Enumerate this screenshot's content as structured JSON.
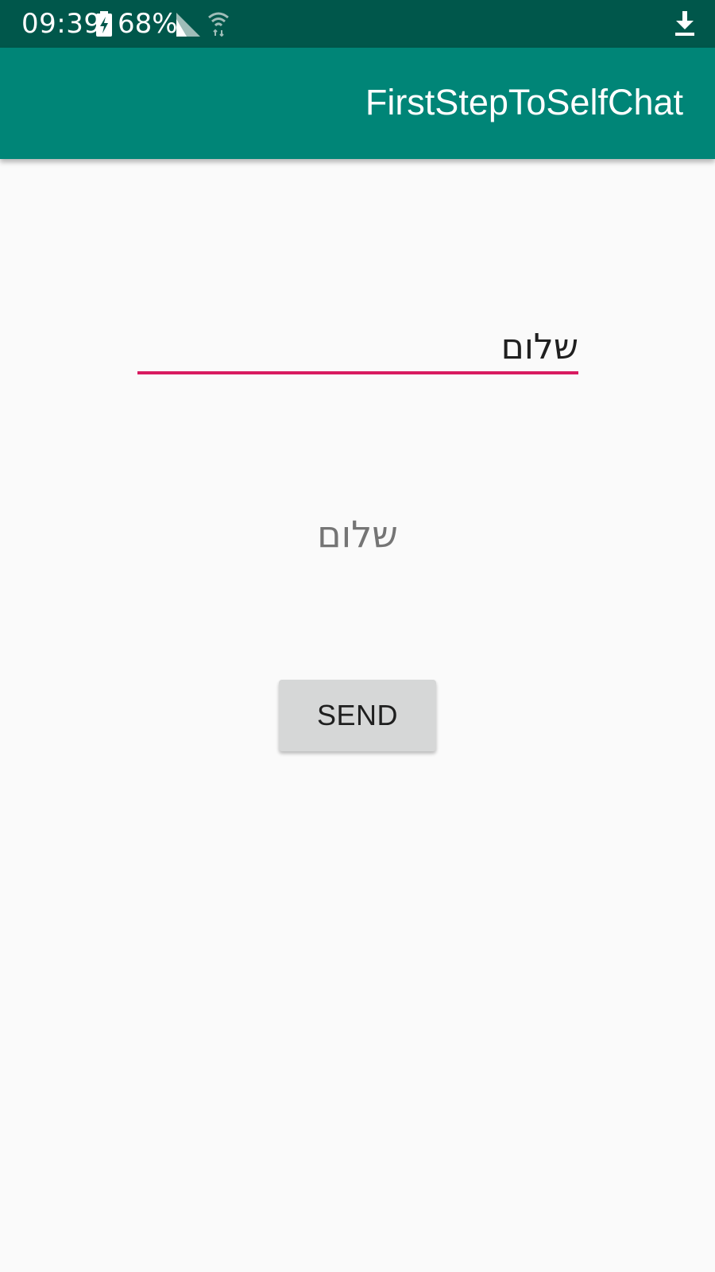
{
  "status_bar": {
    "time": "09:39",
    "battery": "68%",
    "icons": [
      "battery-charging-icon",
      "signal-icon",
      "wifi-icon",
      "download-icon"
    ]
  },
  "app_bar": {
    "title": "FirstStepToSelfChat"
  },
  "main": {
    "input_value": "שלום",
    "output_text": "שלום",
    "send_label": "SEND"
  },
  "colors": {
    "status_bar": "#00574b",
    "app_bar": "#008577",
    "accent": "#d81b60",
    "background": "#fafafa",
    "button": "#d6d7d7"
  }
}
